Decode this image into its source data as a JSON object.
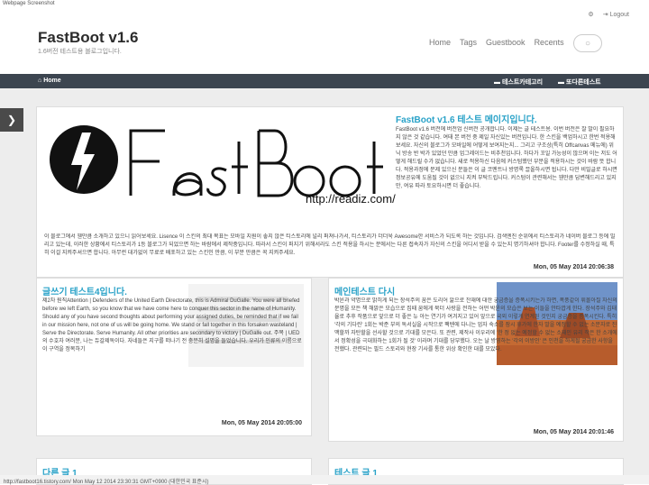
{
  "browser": {
    "title": "Webpage Screenshot"
  },
  "util": {
    "settings": "",
    "logout": "Logout"
  },
  "header": {
    "brand": "FastBoot v1.6",
    "tagline": "1.6버전 테스트용 블로그입니다."
  },
  "nav": [
    "Home",
    "Tags",
    "Guestbook",
    "Recents"
  ],
  "menubar": {
    "home": "Home",
    "cat1": "테스트카테고리",
    "cat2": "또다른테스트"
  },
  "posts": [
    {
      "title": "FastBoot v1.6 테스트 메이지입니다.",
      "logo_url": "http://readiz.com/",
      "body_right": "FastBoot v1.6 버전에 버전업 신버전 공개합니다. 이제는 글 테스트용. 이번 버전은 잘 말이 필요하지 않은 것 같습니다. 여태 본 버전 중 제일 자신있는 버전입니다. 한 스킨을 백업하시고 한번 적용해보세요. 자신의 블로그가 모바일에 어떻게 보여지는지... 그리고 구조상(특히 Offcanvas 메뉴에) 위닉 방송 반 박가 있었던 만큼 업그레이드는 비추천입니다. 하다가 꼬일 가능성이 많으며 이는 저도 어떻게 해드릴 수가 없습니다. 새로 적용하신 다음에 커스텀했던 부분을 적용하시는 것이 바람 뜻 합니다. 적용과정에 문제 있으신 분들은 이 글 코멘트나 방명록 끌올하시면 됩니다. 다만 비밀글로 하시면 정보공유에 도움될 것이 없으니 지켜 부탁드립니다. 커스텀이 관련해서는 웬만큼 답변해드리고 있지만, 여유 따라 토요하시면 더 좋습니다.",
      "body_full": "이 블로그에서 웬만큼 소개하고 있으니 읽어보세요. Lisence 이 스킨의 최대 목표는 모바일 지원이 좋지 않은 티스토리에 널리 퍼져나가서, 티스토리가 더더욱 Awesome한 서비스가 되도록 하는 것입니다. 검색엔진 순위에서 티스토리가 네이버 블로그 등에 밀리고 있는데, 이러한 상황에서 티스토리가 1등 블로그가 되었으면 하는 바람에서 제작중입니다. 따라서 스킨이 퍼지기 위해서라도 스킨 적용을 하시는 분에서는 다른 접속자가 자신의 스킨을 어디서 받을 수 있는지 명기하셔야 합니다. Footer를 수정하실 때, 특히 이걸 지켜주셔으면 합니다. 아무런 대가없이 무료로 배포하고 있는 스킨인 만큼, 이 부분 만큼은 꼭 지켜주세요.",
      "date": "Mon, 05 May 2014 20:06:38"
    },
    {
      "title": "글쓰기 테스트4입니다.",
      "body": "제2차 원칙Attention | Defenders of the United Earth Directorate, this is Admiral DuGalle. You were all briefed before we left Earth, so you know that we have come here to conquer this sector in the name of Humanity. Should any of you have second thoughts about performing your assigned duties, be reminded that if we fail in our mission here, not one of us will be going home. We stand or fall together in this forsaken wasteland | Serve the Directorate. Serve Humanity. All other priorities are secondary to victory | DuGalle out. 주목 | UED의 수호자 여러분, 나는 듀갈제독이다. 자네들은 지구를 떠나기 전 충분히 설명을 들었습니다. 우리가 인류의 이름으로 이 구역을 정복하기",
      "date": "Mon, 05 May 2014 20:05:00"
    },
    {
      "title": "메인테스트 다시",
      "body": "박윤과 약명으로 밝히게 되는 장석주의 꿈은 도리어 앎으로 잔재에 대한 궁금증을 증폭시키는가 하면, 폭풍같이 휘몰아칠 자신의 문명을 모든 책 해맑은 모습으로 집때 꿈에게 묵더 사랑을 전하는 어떤 박윤의 모습은 보는 이들을 안타깝게 한다. 장석주와 김태율로 추후 작품으로 앞으로 더 좋은 뉴 아는 연기가 여겨지고 있어 앞으로 국외 이렇게 연계된 것인지 궁금증을 증폭시킨다. 특히 '각의 기다린' 1회는 박준 부의 독서실을 시작으로 팩텐에 다니는 업자 숙소를 잠시 휴가에 한자 말을 예정할 수 없는 소문자로 진맥할까 자탄할을 선사할 것으로 기대를 모은다. 또 관련, 제작사 이우리에 '한 정 없는 예정할 수 없는 소재인 유리 작은 한 소개에서 정확성을 극대화하는 1회가 될 것' 이라며 기대를 당부했다. 오는 날 방영하는 '각의 이방인' 은 인천을 하게될 궁금한 사항을 전했다. 관련되는 필드 스토리와 현장 기사를 통한 위상 확인한 대를 모았다.",
      "date": "Mon, 05 May 2014 20:01:46"
    },
    {
      "title": "다른 글 1"
    },
    {
      "title": "테스트 글 1"
    }
  ],
  "status_bar": "http://fastboot16.tistory.com/ Mon May 12 2014 23:30:31 GMT+0900 (대한민국 표준시)",
  "colors": {
    "accent": "#29a2c8",
    "menubar": "#3c4550",
    "background": "#ededed"
  }
}
